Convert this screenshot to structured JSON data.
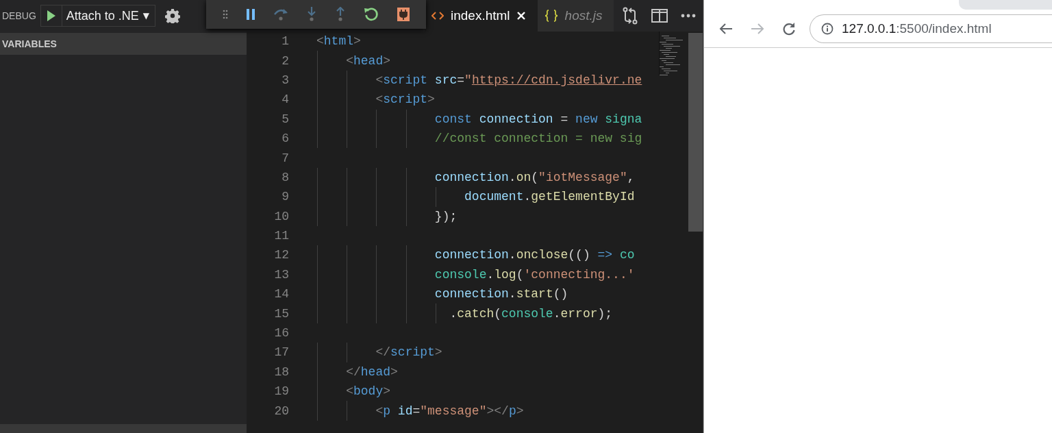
{
  "debug": {
    "label": "DEBUG",
    "config": "Attach to .NE",
    "caret": "▼"
  },
  "sidebar": {
    "sections": [
      {
        "title": "VARIABLES"
      }
    ]
  },
  "tabs": [
    {
      "label": "index.html",
      "selected": true,
      "preview": false,
      "kind": "html"
    },
    {
      "label": "host.js",
      "selected": false,
      "preview": true,
      "kind": "json"
    }
  ],
  "editor": {
    "lines": [
      {
        "number": "1",
        "tokens": [
          {
            "kind": "punct",
            "text": "<"
          },
          {
            "kind": "tag",
            "text": "html"
          },
          {
            "kind": "punct",
            "text": ">"
          }
        ]
      },
      {
        "number": "2",
        "tokens": [
          {
            "kind": "punct",
            "text": "    <"
          },
          {
            "kind": "tag",
            "text": "head"
          },
          {
            "kind": "punct",
            "text": ">"
          }
        ]
      },
      {
        "number": "3",
        "tokens": [
          {
            "kind": "punct",
            "text": "        <"
          },
          {
            "kind": "tag",
            "text": "script"
          },
          {
            "kind": "attr",
            "text": " src"
          },
          {
            "kind": "plain",
            "text": "="
          },
          {
            "kind": "string",
            "text": "\""
          },
          {
            "kind": "link",
            "text": "https://cdn.jsdelivr.ne"
          }
        ]
      },
      {
        "number": "4",
        "tokens": [
          {
            "kind": "punct",
            "text": "        <"
          },
          {
            "kind": "tag",
            "text": "script"
          },
          {
            "kind": "punct",
            "text": ">"
          }
        ]
      },
      {
        "number": "5",
        "tokens": [
          {
            "kind": "keyword",
            "text": "                const"
          },
          {
            "kind": "variable",
            "text": " connection"
          },
          {
            "kind": "plain",
            "text": " = "
          },
          {
            "kind": "keyword",
            "text": "new"
          },
          {
            "kind": "class",
            "text": " signa"
          }
        ]
      },
      {
        "number": "6",
        "tokens": [
          {
            "kind": "comment",
            "text": "                //const connection = new sig"
          }
        ]
      },
      {
        "number": "7"
      },
      {
        "number": "8",
        "tokens": [
          {
            "kind": "variable",
            "text": "                connection"
          },
          {
            "kind": "plain",
            "text": "."
          },
          {
            "kind": "function",
            "text": "on"
          },
          {
            "kind": "plain",
            "text": "("
          },
          {
            "kind": "string",
            "text": "\"iotMessage\""
          },
          {
            "kind": "plain",
            "text": ","
          }
        ]
      },
      {
        "number": "9",
        "tokens": [
          {
            "kind": "variable",
            "text": "                    document"
          },
          {
            "kind": "plain",
            "text": "."
          },
          {
            "kind": "function",
            "text": "getElementById"
          }
        ]
      },
      {
        "number": "10",
        "tokens": [
          {
            "kind": "plain",
            "text": "                });"
          }
        ]
      },
      {
        "number": "11"
      },
      {
        "number": "12",
        "tokens": [
          {
            "kind": "variable",
            "text": "                connection"
          },
          {
            "kind": "plain",
            "text": "."
          },
          {
            "kind": "function",
            "text": "onclose"
          },
          {
            "kind": "plain",
            "text": "(()"
          },
          {
            "kind": "keyword",
            "text": " =>"
          },
          {
            "kind": "class",
            "text": " co"
          }
        ]
      },
      {
        "number": "13",
        "tokens": [
          {
            "kind": "class",
            "text": "                console"
          },
          {
            "kind": "plain",
            "text": "."
          },
          {
            "kind": "function",
            "text": "log"
          },
          {
            "kind": "plain",
            "text": "("
          },
          {
            "kind": "string",
            "text": "'connecting...'"
          }
        ]
      },
      {
        "number": "14",
        "tokens": [
          {
            "kind": "variable",
            "text": "                connection"
          },
          {
            "kind": "plain",
            "text": "."
          },
          {
            "kind": "function",
            "text": "start"
          },
          {
            "kind": "plain",
            "text": "()"
          }
        ]
      },
      {
        "number": "15",
        "tokens": [
          {
            "kind": "plain",
            "text": "                  ."
          },
          {
            "kind": "function",
            "text": "catch"
          },
          {
            "kind": "plain",
            "text": "("
          },
          {
            "kind": "class",
            "text": "console"
          },
          {
            "kind": "plain",
            "text": "."
          },
          {
            "kind": "function",
            "text": "error"
          },
          {
            "kind": "plain",
            "text": ");"
          }
        ]
      },
      {
        "number": "16"
      },
      {
        "number": "17",
        "tokens": [
          {
            "kind": "punct",
            "text": "        </"
          },
          {
            "kind": "tag",
            "text": "script"
          },
          {
            "kind": "punct",
            "text": ">"
          }
        ]
      },
      {
        "number": "18",
        "tokens": [
          {
            "kind": "punct",
            "text": "    </"
          },
          {
            "kind": "tag",
            "text": "head"
          },
          {
            "kind": "punct",
            "text": ">"
          }
        ]
      },
      {
        "number": "19",
        "tokens": [
          {
            "kind": "punct",
            "text": "    <"
          },
          {
            "kind": "tag",
            "text": "body"
          },
          {
            "kind": "punct",
            "text": ">"
          }
        ]
      },
      {
        "number": "20",
        "tokens": [
          {
            "kind": "punct",
            "text": "        <"
          },
          {
            "kind": "tag",
            "text": "p"
          },
          {
            "kind": "attr",
            "text": " id"
          },
          {
            "kind": "plain",
            "text": "="
          },
          {
            "kind": "string",
            "text": "\"message\""
          },
          {
            "kind": "punct",
            "text": "></"
          },
          {
            "kind": "tag",
            "text": "p"
          },
          {
            "kind": "punct",
            "text": ">"
          }
        ]
      }
    ]
  },
  "browser": {
    "url_host": "127.0.0.1",
    "url_rest": ":5500/index.html"
  }
}
